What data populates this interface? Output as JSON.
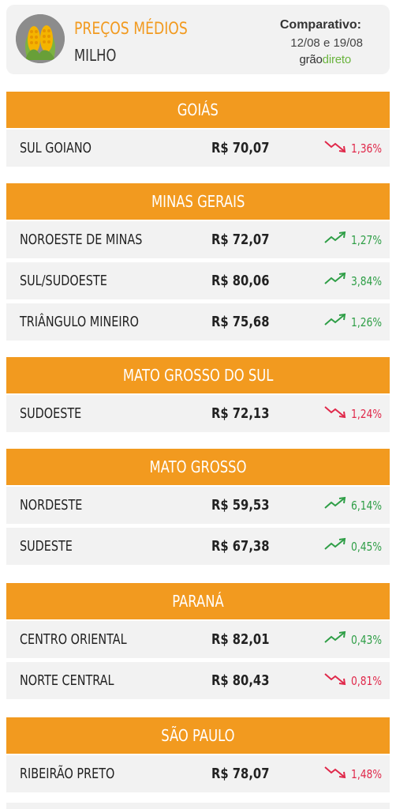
{
  "header": {
    "title": "PREÇOS MÉDIOS",
    "subtitle": "MILHO",
    "comparison_label": "Comparativo:",
    "comparison_dates": "12/08 e 19/08",
    "brand_part1": "grão",
    "brand_part2": "direto"
  },
  "colors": {
    "accent": "#f29a1f",
    "row_bg": "#f2f2f2",
    "up": "#2e9e46",
    "down": "#e0284a",
    "brand_green": "#6ab43e"
  },
  "icons": {
    "logo": "corn-icon",
    "up": "trend-up-icon",
    "down": "trend-down-icon"
  },
  "states": [
    {
      "name": "GOIÁS",
      "rows": [
        {
          "region": "SUL GOIANO",
          "price": "R$ 70,07",
          "direction": "down",
          "change": "1,36%"
        }
      ]
    },
    {
      "name": "MINAS GERAIS",
      "rows": [
        {
          "region": "NOROESTE DE MINAS",
          "price": "R$ 72,07",
          "direction": "up",
          "change": "1,27%"
        },
        {
          "region": "SUL/SUDOESTE",
          "price": "R$ 80,06",
          "direction": "up",
          "change": "3,84%"
        },
        {
          "region": "TRIÂNGULO MINEIRO",
          "price": "R$ 75,68",
          "direction": "up",
          "change": "1,26%"
        }
      ]
    },
    {
      "name": "MATO GROSSO DO SUL",
      "rows": [
        {
          "region": "SUDOESTE",
          "price": "R$ 72,13",
          "direction": "down",
          "change": "1,24%"
        }
      ]
    },
    {
      "name": "MATO GROSSO",
      "rows": [
        {
          "region": "NORDESTE",
          "price": "R$ 59,53",
          "direction": "up",
          "change": "6,14%"
        },
        {
          "region": "SUDESTE",
          "price": "R$ 67,38",
          "direction": "up",
          "change": "0,45%"
        }
      ]
    },
    {
      "name": "PARANÁ",
      "rows": [
        {
          "region": "CENTRO ORIENTAL",
          "price": "R$ 82,01",
          "direction": "up",
          "change": "0,43%"
        },
        {
          "region": "NORTE CENTRAL",
          "price": "R$ 80,43",
          "direction": "down",
          "change": "0,81%"
        }
      ]
    },
    {
      "name": "SÃO PAULO",
      "rows": [
        {
          "region": "RIBEIRÃO PRETO",
          "price": "R$ 78,07",
          "direction": "down",
          "change": "1,48%"
        }
      ]
    }
  ]
}
